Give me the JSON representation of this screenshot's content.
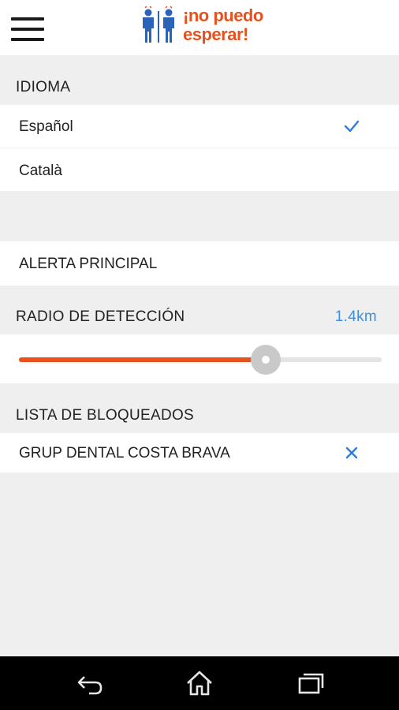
{
  "app": {
    "logo_line1": "¡no puedo",
    "logo_line2": "esperar!",
    "brand_color": "#e7511e",
    "accent_color": "#2a7de1"
  },
  "idioma": {
    "header": "IDIOMA",
    "options": [
      {
        "label": "Español",
        "selected": true,
        "icon": "check-icon"
      },
      {
        "label": "Català",
        "selected": false
      }
    ]
  },
  "alerta": {
    "label": "ALERTA PRINCIPAL"
  },
  "radio": {
    "header": "RADIO DE DETECCIÓN",
    "value_text": "1.4km",
    "slider_fraction": 0.68
  },
  "bloqueados": {
    "header": "LISTA DE BLOQUEADOS",
    "items": [
      {
        "label": "GRUP DENTAL COSTA BRAVA",
        "icon": "close-icon"
      }
    ]
  },
  "system_nav": {
    "back_icon": "back-icon",
    "home_icon": "home-icon",
    "recents_icon": "recents-icon"
  }
}
